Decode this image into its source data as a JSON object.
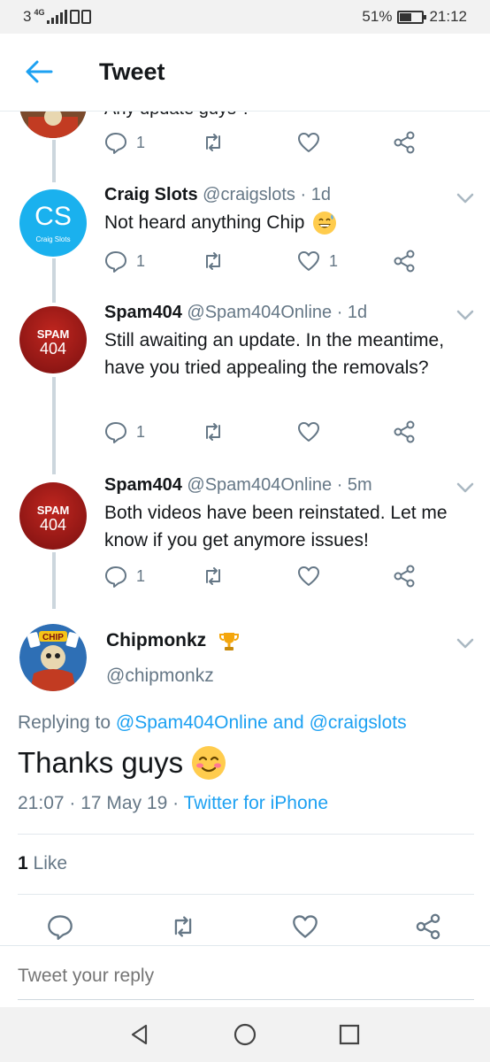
{
  "status_bar": {
    "carrier": "3",
    "network": "4G",
    "battery_percent": "51%",
    "battery_level": 0.51,
    "time": "21:12"
  },
  "header": {
    "title": "Tweet",
    "back_icon": "back-arrow-icon"
  },
  "partial_tweet": {
    "text": "Any update guys ?",
    "reply_count": "1"
  },
  "thread": [
    {
      "name": "Craig Slots",
      "handle": "@craigslots",
      "time": "· 1d",
      "text": "Not heard anything Chip",
      "emoji": "grinning-sweat-emoji",
      "reply_count": "1",
      "like_count": "1",
      "avatar_text": "CS",
      "avatar_subtext": "Craig Slots"
    },
    {
      "name": "Spam404",
      "handle": "@Spam404Online",
      "time": "· 1d",
      "text": "Still awaiting an update. In the meantime, have you tried appealing the removals?",
      "reply_count": "1",
      "like_count": "",
      "avatar_text_top": "SPAM",
      "avatar_text_bottom": "404"
    },
    {
      "name": "Spam404",
      "handle": "@Spam404Online",
      "time": "· 5m",
      "text": "Both videos have been reinstated. Let me know if you get anymore issues!",
      "reply_count": "1",
      "like_count": "",
      "avatar_text_top": "SPAM",
      "avatar_text_bottom": "404"
    }
  ],
  "main_tweet": {
    "name": "Chipmonkz",
    "handle": "@chipmonkz",
    "avatar_text": "CHIP",
    "replying_prefix": "Replying to",
    "replying_user1": "@Spam404Online",
    "replying_and": "and",
    "replying_user2": "@craigslots",
    "text": "Thanks guys",
    "emoji": "smiling-blush-emoji",
    "time": "21:07",
    "date": "17 May 19",
    "source": "Twitter for iPhone",
    "like_count": "1",
    "like_label": "Like"
  },
  "reply_bar": {
    "placeholder": "Tweet your reply"
  },
  "colors": {
    "twitter_blue": "#1da1f2",
    "gray_text": "#657786",
    "spam_red": "#a11b1b"
  }
}
